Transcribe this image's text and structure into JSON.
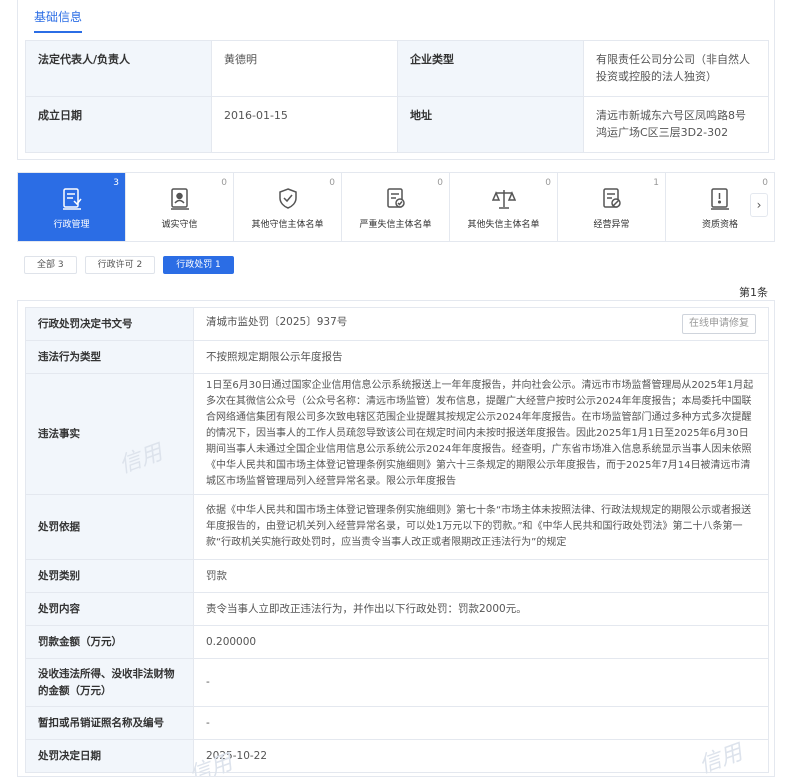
{
  "basic": {
    "tab_label": "基础信息",
    "rows": [
      {
        "k1": "法定代表人/负责人",
        "v1": "黄德明",
        "k2": "企业类型",
        "v2": "有限责任公司分公司（非自然人投资或控股的法人独资）"
      },
      {
        "k1": "成立日期",
        "v1": "2016-01-15",
        "k2": "地址",
        "v2": "清远市新城东六号区凤鸣路8号鸿运广场C区三层3D2-302"
      }
    ]
  },
  "tabs": [
    {
      "label": "行政管理",
      "count": "3",
      "icon": "admin-doc-icon"
    },
    {
      "label": "诚实守信",
      "count": "0",
      "icon": "honesty-icon"
    },
    {
      "label": "其他守信主体名单",
      "count": "0",
      "icon": "shield-check-icon"
    },
    {
      "label": "严重失信主体名单",
      "count": "0",
      "icon": "severe-doc-icon"
    },
    {
      "label": "其他失信主体名单",
      "count": "0",
      "icon": "scale-icon"
    },
    {
      "label": "经营异常",
      "count": "1",
      "icon": "abnormal-doc-icon"
    },
    {
      "label": "资质资格",
      "count": "0",
      "icon": "license-icon"
    }
  ],
  "filters": {
    "all": "全部 3",
    "permit": "行政许可 2",
    "penalty": "行政处罚 1"
  },
  "record_count": "第1条",
  "correction_button": "在线申请修复",
  "detail": [
    {
      "k": "行政处罚决定书文号",
      "v": "清城市监处罚〔2025〕937号"
    },
    {
      "k": "违法行为类型",
      "v": "不按照规定期限公示年度报告"
    },
    {
      "k": "违法事实",
      "v": "1日至6月30日通过国家企业信用信息公示系统报送上一年年度报告，并向社会公示。清远市市场监督管理局从2025年1月起多次在其微信公众号（公众号名称：清远市场监管）发布信息，提醒广大经营户按时公示2024年年度报告；本局委托中国联合网络通信集团有限公司多次致电辖区范围企业提醒其按规定公示2024年年度报告。在市场监管部门通过多种方式多次提醒的情况下，因当事人的工作人员疏忽导致该公司在规定时间内未按时报送年度报告。因此2025年1月1日至2025年6月30日期间当事人未通过全国企业信用信息公示系统公示2024年年度报告。经查明，广东省市场准入信息系统显示当事人因未依照《中华人民共和国市场主体登记管理条例实施细则》第六十三条规定的期限公示年度报告，而于2025年7月14日被清远市清城区市场监督管理局列入经营异常名录。限公示年度报告"
    },
    {
      "k": "处罚依据",
      "v": "依据《中华人民共和国市场主体登记管理条例实施细则》第七十条“市场主体未按照法律、行政法规规定的期限公示或者报送年度报告的，由登记机关列入经营异常名录，可以处1万元以下的罚款。”和《中华人民共和国行政处罚法》第二十八条第一款“行政机关实施行政处罚时，应当责令当事人改正或者限期改正违法行为”的规定"
    },
    {
      "k": "处罚类别",
      "v": "罚款"
    },
    {
      "k": "处罚内容",
      "v": "责令当事人立即改正违法行为，并作出以下行政处罚：罚款2000元。"
    },
    {
      "k": "罚款金额（万元）",
      "v": "0.200000"
    },
    {
      "k": "没收违法所得、没收非法财物的金额（万元）",
      "v": "-"
    },
    {
      "k": "暂扣或吊销证照名称及编号",
      "v": "-"
    },
    {
      "k": "处罚决定日期",
      "v": "2025-10-22"
    }
  ]
}
